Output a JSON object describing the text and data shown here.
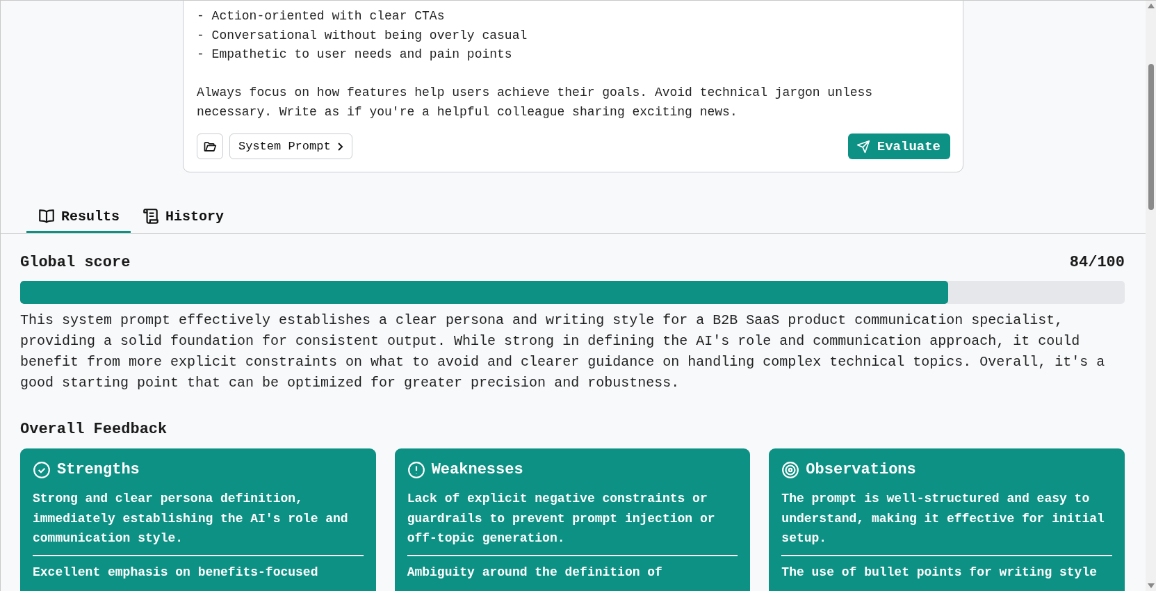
{
  "prompt": {
    "text": "- Action-oriented with clear CTAs\n- Conversational without being overly casual\n- Empathetic to user needs and pain points\n\nAlways focus on how features help users achieve their goals. Avoid technical jargon unless necessary. Write as if you're a helpful colleague sharing exciting news."
  },
  "toolbar": {
    "system_prompt_button": "System Prompt",
    "evaluate_button": "Evaluate"
  },
  "tabs": [
    {
      "kind": "book",
      "label": "Results",
      "selected": true
    },
    {
      "kind": "scroll",
      "label": "History",
      "selected": false
    }
  ],
  "score": {
    "title": "Global score",
    "value": "84/100",
    "level": 0.84
  },
  "summary": "This system prompt effectively establishes a clear persona and writing style for a B2B SaaS product communication specialist, providing a solid foundation for consistent output. While strong in defining the AI's role and communication approach, it could benefit from more explicit constraints on what to avoid and clearer guidance on handling complex technical topics. Overall, it's a good starting point that can be optimized for greater precision and robustness.",
  "feedback": {
    "title": "Overall Feedback",
    "cards": [
      {
        "kind": "strengths",
        "title": "Strengths",
        "items": [
          "Strong and clear persona definition, immediately establishing the AI's role and communication style.",
          "Excellent emphasis on benefits-focused"
        ]
      },
      {
        "kind": "weaknesses",
        "title": "Weaknesses",
        "items": [
          "Lack of explicit negative constraints or guardrails to prevent prompt injection or off-topic generation.",
          "Ambiguity around the definition of"
        ]
      },
      {
        "kind": "observations",
        "title": "Observations",
        "items": [
          "The prompt is well-structured and easy to understand, making it effective for initial setup.",
          "The use of bullet points for writing style"
        ]
      }
    ]
  }
}
